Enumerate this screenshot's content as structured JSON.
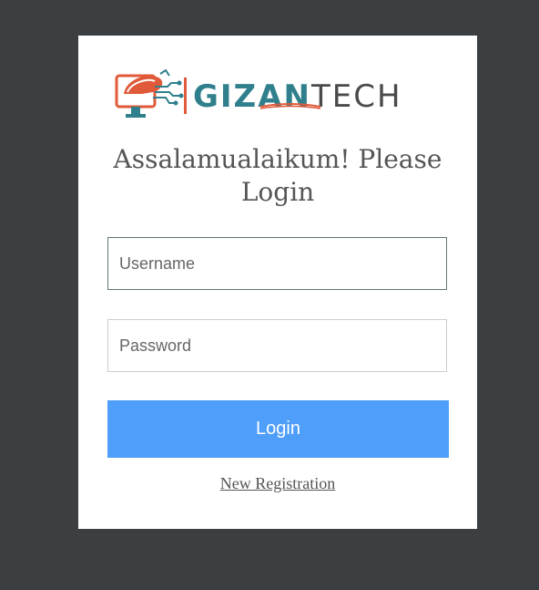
{
  "logo": {
    "brand_part1": "GIZAN",
    "brand_part2": "TECH",
    "icon": "computer-circuit-logo-icon",
    "colors": {
      "teal": "#2f7f8c",
      "orange": "#e05a3a",
      "gray": "#4a4a4a"
    }
  },
  "heading": "Assalamualaikum! Please Login",
  "form": {
    "username_placeholder": "Username",
    "password_placeholder": "Password",
    "login_label": "Login",
    "registration_link": "New Registration"
  },
  "colors": {
    "background": "#3b3f42",
    "card": "#ffffff",
    "button": "#4f9ef9"
  }
}
